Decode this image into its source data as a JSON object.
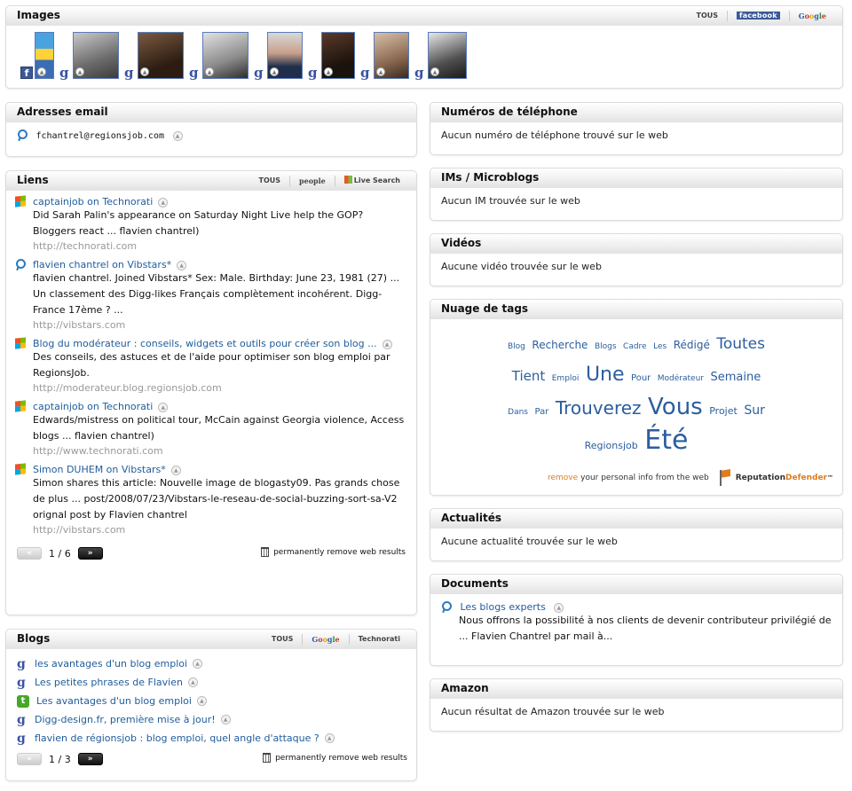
{
  "images": {
    "title": "Images",
    "sources": [
      "TOUS",
      "facebook",
      "Google"
    ],
    "thumbs": [
      {
        "source": "facebook",
        "badge": "f",
        "width": 22,
        "bg": "linear-gradient(#4aa3e0 0%, #4aa3e0 35%, #ffd23a 35%, #ffd23a 60%, #3b6db5 60%)"
      },
      {
        "source": "google",
        "badge": "g",
        "width": 52,
        "bg": "linear-gradient(160deg,#c9c9c9,#6b6b6b 60%,#3c3c3c)"
      },
      {
        "source": "google",
        "badge": "g",
        "width": 52,
        "bg": "linear-gradient(160deg,#7a5a40,#2c1c12 70%)"
      },
      {
        "source": "google",
        "badge": "g",
        "width": 52,
        "bg": "linear-gradient(160deg,#e2e2e2,#8a8a8a 60%,#2e2e2e)"
      },
      {
        "source": "google",
        "badge": "g",
        "width": 40,
        "bg": "linear-gradient(180deg,#d8d8d8 0%,#c8a08a 45%,#1f2e4a 75%)"
      },
      {
        "source": "google",
        "badge": "g",
        "width": 38,
        "bg": "linear-gradient(160deg,#5a3a2a,#1a120c 70%)"
      },
      {
        "source": "google",
        "badge": "g",
        "width": 40,
        "bg": "linear-gradient(160deg,#d8c0a8,#8a6850 60%,#3a2a20)"
      },
      {
        "source": "google",
        "badge": "g",
        "width": 44,
        "bg": "linear-gradient(160deg,#e8e8e8,#505050 60%,#1a1a1a)"
      }
    ]
  },
  "emails": {
    "title": "Adresses email",
    "items": [
      {
        "address": "fchantrel@regionsjob.com"
      }
    ]
  },
  "links": {
    "title": "Liens",
    "sources": [
      "TOUS",
      "people",
      "Live Search"
    ],
    "items": [
      {
        "icon": "windows",
        "title": "captainjob on Technorati",
        "desc": "Did Sarah Palin's appearance on Saturday Night Live help the GOP? Bloggers react ... flavien chantrel)",
        "url": "http://technorati.com"
      },
      {
        "icon": "people",
        "title": "flavien chantrel on Vibstars*",
        "desc": "flavien chantrel. Joined Vibstars* Sex: Male. Birthday: June 23, 1981 (27) ... Un classement des Digg-likes Français complètement incohérent. Digg-France 17ème ? ...",
        "url": "http://vibstars.com"
      },
      {
        "icon": "windows",
        "title": "Blog du modérateur : conseils, widgets et outils pour créer son blog ...",
        "desc": "Des conseils, des astuces et de l'aide pour optimiser son blog emploi par RegionsJob.",
        "url": "http://moderateur.blog.regionsjob.com"
      },
      {
        "icon": "windows",
        "title": "captainjob on Technorati",
        "desc": "Edwards/mistress on political tour, McCain against Georgia violence, Access blogs ... flavien chantrel)",
        "url": "http://www.technorati.com"
      },
      {
        "icon": "windows",
        "title": "Simon DUHEM on Vibstars*",
        "desc": "Simon shares this article: Nouvelle image de blogasty09. Pas grands chose de plus ... post/2008/07/23/Vibstars-le-reseau-de-social-buzzing-sort-sa-V2 orignal post by Flavien chantrel",
        "url": "http://vibstars.com"
      }
    ],
    "pager": {
      "prev": "«",
      "next": "»",
      "current": "1",
      "total": "6",
      "sep": "/"
    },
    "remove_label": "permanently remove web results"
  },
  "blogs": {
    "title": "Blogs",
    "sources": [
      "TOUS",
      "Google",
      "Technorati"
    ],
    "items": [
      {
        "icon": "google",
        "title": "les avantages d'un blog emploi"
      },
      {
        "icon": "google",
        "title": "Les petites phrases de Flavien"
      },
      {
        "icon": "technorati",
        "title": "Les avantages d'un blog emploi"
      },
      {
        "icon": "google",
        "title": "Digg-design.fr, première mise à jour!"
      },
      {
        "icon": "google",
        "title": "flavien de régionsjob : blog emploi, quel angle d'attaque ?"
      }
    ],
    "pager": {
      "prev": "«",
      "next": "»",
      "current": "1",
      "total": "3",
      "sep": "/"
    },
    "remove_label": "permanently remove web results"
  },
  "phones": {
    "title": "Numéros de téléphone",
    "message": "Aucun numéro de téléphone trouvé sur le web"
  },
  "ims": {
    "title": "IMs / Microblogs",
    "message": "Aucun IM trouvée sur le web"
  },
  "videos": {
    "title": "Vidéos",
    "message": "Aucune vidéo trouvée sur le web"
  },
  "tags": {
    "title": "Nuage de tags",
    "lines": [
      [
        {
          "t": "Blog",
          "s": 9
        },
        {
          "t": "Recherche",
          "s": 12
        },
        {
          "t": "Blogs",
          "s": 9
        },
        {
          "t": "Cadre",
          "s": 9
        },
        {
          "t": "Les",
          "s": 9
        },
        {
          "t": "Rédigé",
          "s": 12
        },
        {
          "t": "Toutes",
          "s": 17
        }
      ],
      [
        {
          "t": "Tient",
          "s": 15
        },
        {
          "t": "Emploi",
          "s": 9
        },
        {
          "t": "Une",
          "s": 22
        },
        {
          "t": "Pour",
          "s": 10
        },
        {
          "t": "Modérateur",
          "s": 9
        },
        {
          "t": "Semaine",
          "s": 13
        }
      ],
      [
        {
          "t": "Dans",
          "s": 9
        },
        {
          "t": "Par",
          "s": 10
        },
        {
          "t": "Trouverez",
          "s": 20
        },
        {
          "t": "Vous",
          "s": 26
        },
        {
          "t": "Projet",
          "s": 11
        },
        {
          "t": "Sur",
          "s": 14
        }
      ],
      [
        {
          "t": "Regionsjob",
          "s": 11
        },
        {
          "t": "Été",
          "s": 30
        }
      ]
    ],
    "remove_word": "remove",
    "remove_rest": "your personal info from the web",
    "brand_a": "Reputation",
    "brand_b": "Defender",
    "brand_tm": "™"
  },
  "news": {
    "title": "Actualités",
    "message": "Aucune actualité trouvée sur le web"
  },
  "documents": {
    "title": "Documents",
    "items": [
      {
        "title": "Les blogs experts",
        "desc": "Nous offrons la possibilité à nos clients de devenir contributeur privilégié de ... Flavien Chantrel par mail à..."
      }
    ]
  },
  "amazon": {
    "title": "Amazon",
    "message": "Aucun résultat de Amazon trouvée sur le web"
  }
}
